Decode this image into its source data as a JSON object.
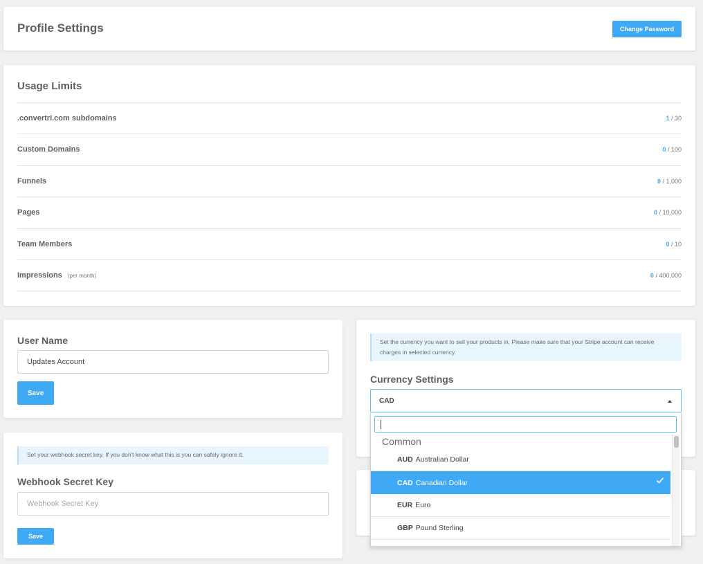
{
  "profile": {
    "title": "Profile Settings",
    "change_password_label": "Change Password"
  },
  "usage": {
    "title": "Usage Limits",
    "rows": [
      {
        "label": ".convertri.com subdomains",
        "note": "",
        "used": "1",
        "limit": "/ 30"
      },
      {
        "label": "Custom Domains",
        "note": "",
        "used": "0",
        "limit": "/ 100"
      },
      {
        "label": "Funnels",
        "note": "",
        "used": "0",
        "limit": "/ 1,000"
      },
      {
        "label": "Pages",
        "note": "",
        "used": "0",
        "limit": "/ 10,000"
      },
      {
        "label": "Team Members",
        "note": "",
        "used": "0",
        "limit": "/ 10"
      },
      {
        "label": "Impressions",
        "note": "(per month)",
        "used": "0",
        "limit": "/ 400,000"
      }
    ]
  },
  "user_name": {
    "title": "User Name",
    "value": "Updates Account",
    "save_label": "Save"
  },
  "webhook": {
    "info": "Set your webhook secret key. If you don't know what this is you can safely ignore it.",
    "title": "Webhook Secret Key",
    "placeholder": "Webhook Secret Key",
    "save_label": "Save"
  },
  "currency": {
    "info": "Set the currency you want to sell your products in. Please make sure that your Stripe account can receive charges in selected currency.",
    "title": "Currency Settings",
    "selected": "CAD",
    "search_value": "",
    "group_label": "Common",
    "options": [
      {
        "code": "AUD",
        "name": "Australian Dollar",
        "selected": false
      },
      {
        "code": "CAD",
        "name": "Canadian Dollar",
        "selected": true
      },
      {
        "code": "EUR",
        "name": "Euro",
        "selected": false
      },
      {
        "code": "GBP",
        "name": "Pound Sterling",
        "selected": false
      }
    ]
  },
  "icons": {
    "caret": "caret-up-icon",
    "check": "checkmark-icon"
  },
  "colors": {
    "accent": "#3fa9f5",
    "background": "#f0f0f0",
    "info_bg": "#e9f5fd"
  }
}
